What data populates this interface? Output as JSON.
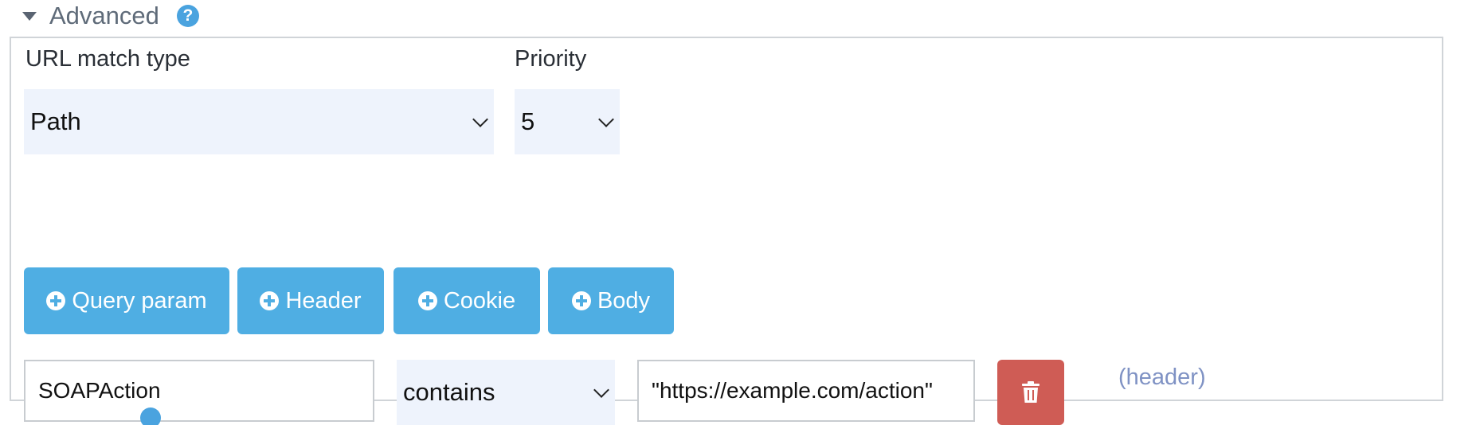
{
  "section": {
    "title": "Advanced",
    "help_icon": "?"
  },
  "url_match": {
    "label": "URL match type",
    "value": "Path"
  },
  "priority": {
    "label": "Priority",
    "value": "5"
  },
  "add_buttons": {
    "query_param": "Query param",
    "header": "Header",
    "cookie": "Cookie",
    "body": "Body"
  },
  "matcher_row": {
    "key": "SOAPAction",
    "operator": "contains",
    "value": "\"https://example.com/action\"",
    "type_tag": "(header)"
  },
  "colors": {
    "accent": "#4faee3",
    "danger": "#cf5c55",
    "select_bg": "#eef3fc",
    "help": "#4aa3df"
  }
}
